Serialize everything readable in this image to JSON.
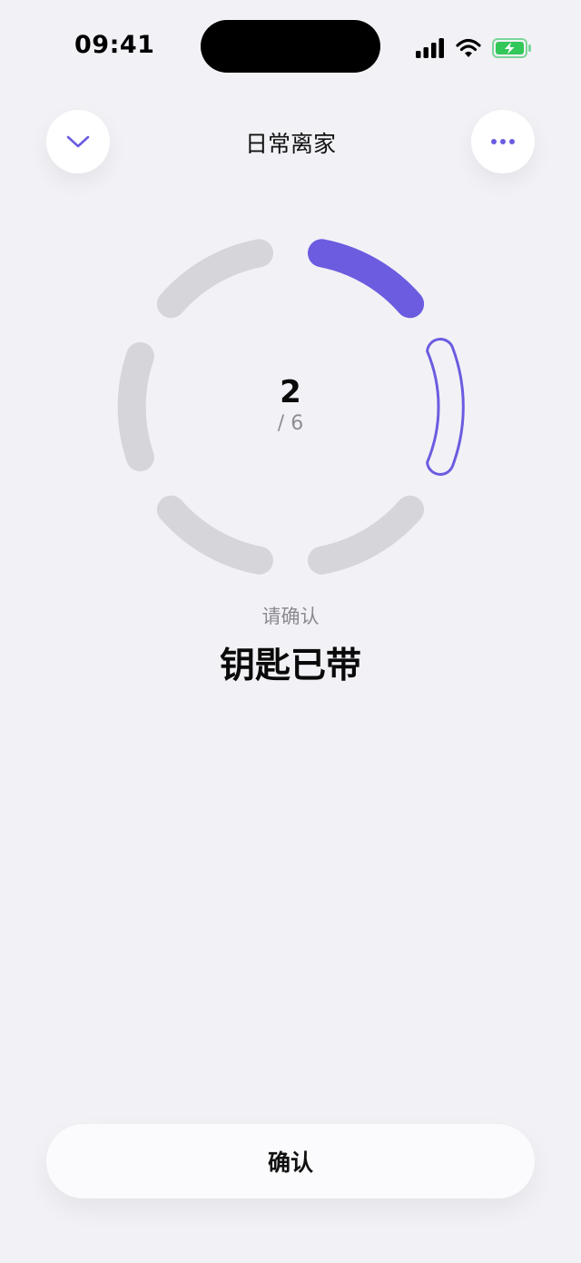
{
  "status_bar": {
    "time": "09:41",
    "icons": [
      "signal-icon",
      "wifi-icon",
      "battery-charging-icon"
    ],
    "battery_color": "#34c759"
  },
  "header": {
    "title": "日常离家",
    "left_button_icon": "chevron-down-icon",
    "right_button_icon": "more-horizontal-icon"
  },
  "progress": {
    "current": "2",
    "total": "/ 6",
    "segments_total": 6,
    "segments_completed": 1,
    "active_segment_index": 1,
    "accent_color": "#6b5ce0",
    "inactive_color": "#d5d5da"
  },
  "prompt": "请确认",
  "item_title": "钥匙已带",
  "confirm_button": {
    "label": "确认"
  }
}
